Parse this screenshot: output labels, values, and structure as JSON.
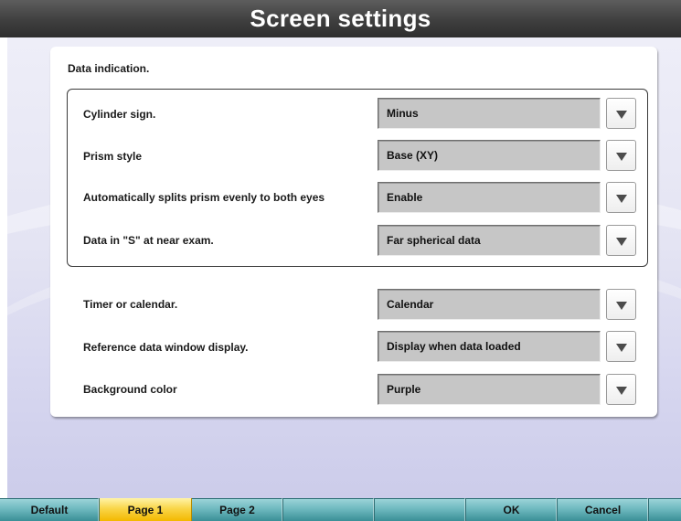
{
  "window": {
    "title": "Screen settings"
  },
  "panel": {
    "section_title": "Data indication.",
    "group_rows": [
      {
        "label": "Cylinder sign.",
        "value": "Minus"
      },
      {
        "label": "Prism style",
        "value": "Base (XY)"
      },
      {
        "label": "Automatically splits prism evenly to both eyes",
        "value": "Enable"
      },
      {
        "label": "Data in \"S\" at near exam.",
        "value": "Far spherical data"
      }
    ],
    "rows": [
      {
        "label": "Timer or calendar.",
        "value": "Calendar"
      },
      {
        "label": "Reference data window display.",
        "value": "Display when data loaded"
      },
      {
        "label": "Background color",
        "value": "Purple"
      }
    ]
  },
  "bottom_bar": {
    "tabs": [
      "Default",
      "Page 1",
      "Page 2",
      "",
      "",
      "OK",
      "Cancel"
    ],
    "active_tab": "Page 1"
  },
  "colors": {
    "active_tab": "#f5c000",
    "bar": "#6fb9bf",
    "field": "#c6c6c6",
    "title_bg": "#3f3f3f"
  },
  "icons": {
    "dropdown": "triangle-down-icon"
  }
}
